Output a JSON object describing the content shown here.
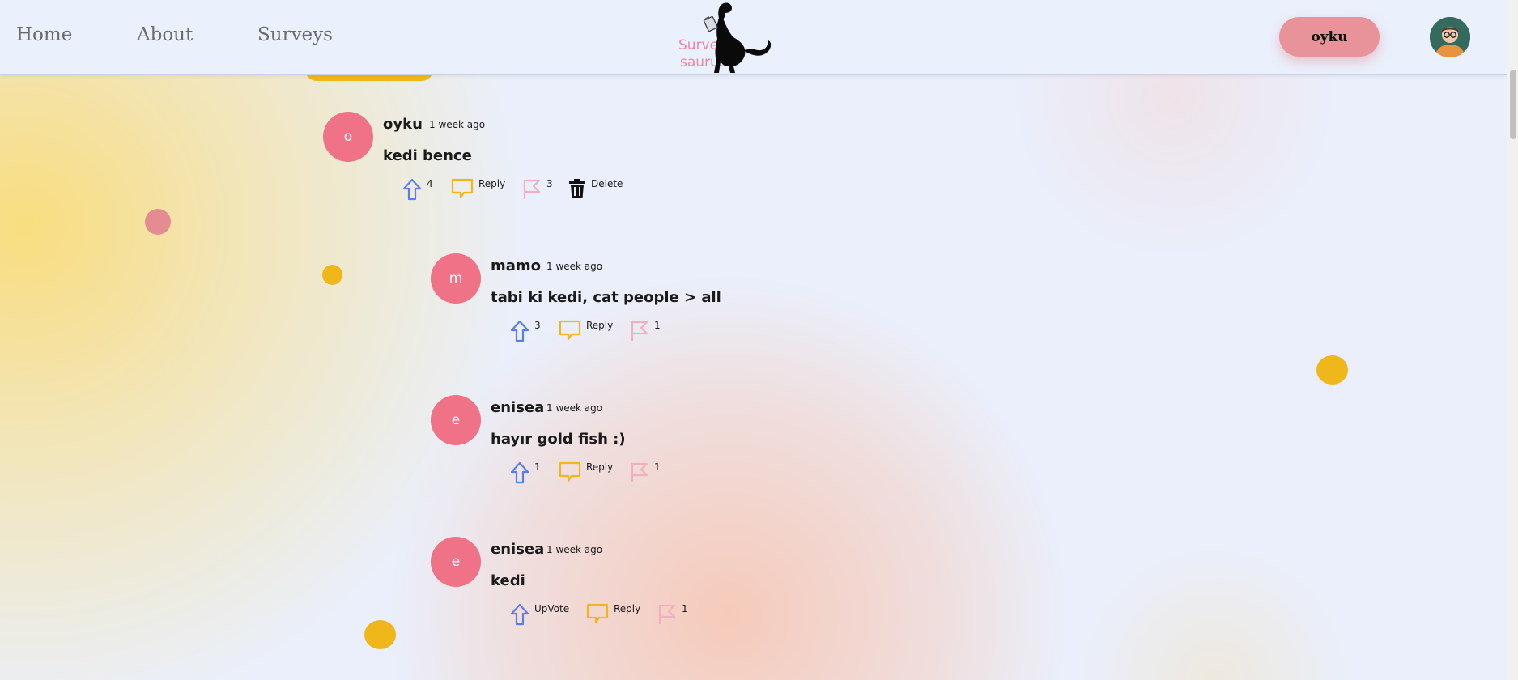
{
  "nav": {
    "home": "Home",
    "about": "About",
    "surveys": "Surveys"
  },
  "logo": {
    "line1": "Survey",
    "line2": "saurus"
  },
  "user": {
    "name": "oyku"
  },
  "colors": {
    "avatar": "#ef7287",
    "upvote": "#5b7ee5",
    "reply": "#f0b71b",
    "flag": "#f0b0c0",
    "user_button": "#e89399"
  },
  "comments": [
    {
      "initial": "o",
      "username": "oyku",
      "time": "1 week ago",
      "text": "kedi bence",
      "upvotes": "4",
      "reply_label": "Reply",
      "flags": "3",
      "delete_label": "Delete"
    },
    {
      "initial": "m",
      "username": "mamo",
      "time": "1 week ago",
      "text": "tabi ki kedi, cat people > all",
      "upvotes": "3",
      "reply_label": "Reply",
      "flags": "1"
    },
    {
      "initial": "e",
      "username": "enisea",
      "time": "1 week ago",
      "text": "hayır gold fish :)",
      "upvotes": "1",
      "reply_label": "Reply",
      "flags": "1"
    },
    {
      "initial": "e",
      "username": "enisea",
      "time": "1 week ago",
      "text": "kedi",
      "upvotes": "UpVote",
      "reply_label": "Reply",
      "flags": "1"
    }
  ]
}
